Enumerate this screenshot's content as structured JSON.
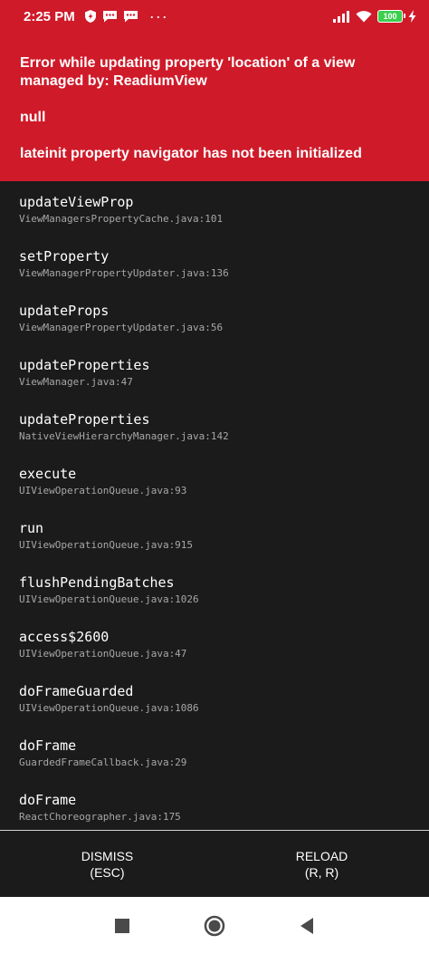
{
  "status_bar": {
    "time": "2:25 PM",
    "battery": "100",
    "icons": [
      "shield-icon",
      "chat-icon",
      "chat-icon",
      "more-icon",
      "signal-icon",
      "wifi-icon",
      "battery-icon",
      "charging-icon"
    ],
    "more": "···"
  },
  "error": {
    "title": "Error while updating property 'location' of a view managed by: ReadiumView",
    "line1": "null",
    "line2": "lateinit property navigator has not been initialized",
    "background": "#cf1a29"
  },
  "stack": [
    {
      "method": "updateViewProp",
      "file": "ViewManagersPropertyCache.java:101"
    },
    {
      "method": "setProperty",
      "file": "ViewManagerPropertyUpdater.java:136"
    },
    {
      "method": "updateProps",
      "file": "ViewManagerPropertyUpdater.java:56"
    },
    {
      "method": "updateProperties",
      "file": "ViewManager.java:47"
    },
    {
      "method": "updateProperties",
      "file": "NativeViewHierarchyManager.java:142"
    },
    {
      "method": "execute",
      "file": "UIViewOperationQueue.java:93"
    },
    {
      "method": "run",
      "file": "UIViewOperationQueue.java:915"
    },
    {
      "method": "flushPendingBatches",
      "file": "UIViewOperationQueue.java:1026"
    },
    {
      "method": "access$2600",
      "file": "UIViewOperationQueue.java:47"
    },
    {
      "method": "doFrameGuarded",
      "file": "UIViewOperationQueue.java:1086"
    },
    {
      "method": "doFrame",
      "file": "GuardedFrameCallback.java:29"
    },
    {
      "method": "doFrame",
      "file": "ReactChoreographer.java:175"
    }
  ],
  "actions": {
    "dismiss": {
      "label": "DISMISS",
      "shortcut": "(ESC)"
    },
    "reload": {
      "label": "RELOAD",
      "shortcut": "(R, R)"
    }
  },
  "navbar": {
    "icons": [
      "recents-square-icon",
      "home-circle-icon",
      "back-triangle-icon"
    ]
  }
}
